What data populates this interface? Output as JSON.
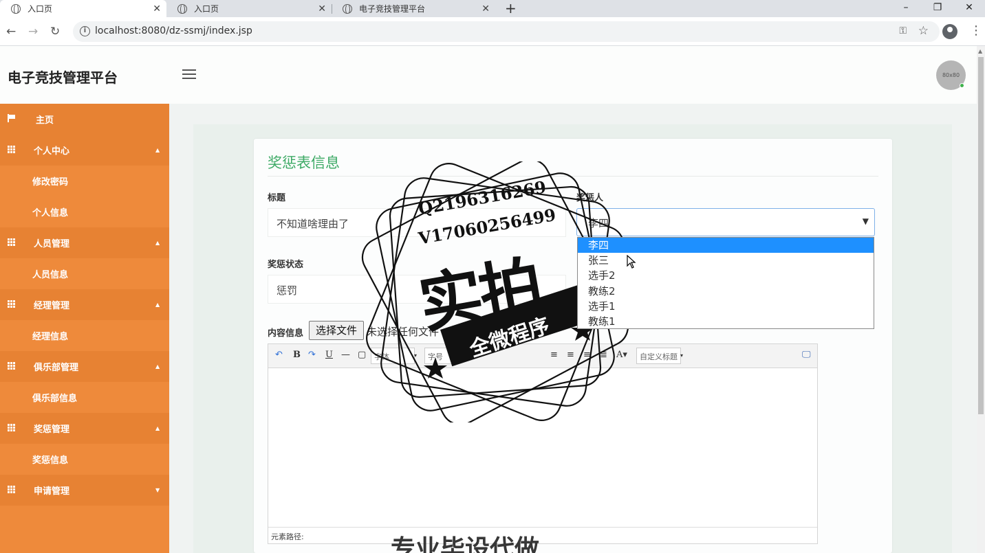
{
  "browser": {
    "tabs": [
      {
        "title": "入口页",
        "close": "✕"
      },
      {
        "title": "入口页",
        "close": "✕"
      },
      {
        "title": "电子竞技管理平台",
        "close": "✕"
      }
    ],
    "new_tab": "+",
    "url": "localhost:8080/dz-ssmj/index.jsp"
  },
  "app": {
    "brand": "电子竞技管理平台",
    "avatar_text": "80x80"
  },
  "sidebar": {
    "home": "主页",
    "items": [
      {
        "label": "个人中心",
        "type": "group"
      },
      {
        "label": "修改密码",
        "type": "sub"
      },
      {
        "label": "个人信息",
        "type": "sub"
      },
      {
        "label": "人员管理",
        "type": "group"
      },
      {
        "label": "人员信息",
        "type": "sub"
      },
      {
        "label": "经理管理",
        "type": "group"
      },
      {
        "label": "经理信息",
        "type": "sub"
      },
      {
        "label": "俱乐部管理",
        "type": "group"
      },
      {
        "label": "俱乐部信息",
        "type": "sub"
      },
      {
        "label": "奖惩管理",
        "type": "group"
      },
      {
        "label": "奖惩信息",
        "type": "sub"
      },
      {
        "label": "申请管理",
        "type": "group"
      }
    ]
  },
  "form": {
    "title": "奖惩表信息",
    "title_label": "标题",
    "title_value": "不知道啥理由了",
    "person_label": "奖惩人",
    "person_value": "李四",
    "person_options": [
      "李四",
      "张三",
      "选手2",
      "教练2",
      "选手1",
      "教练1"
    ],
    "status_label": "奖惩状态",
    "status_value": "惩罚",
    "content_label": "内容信息",
    "file_button": "选择文件",
    "file_status": "未选择任何文件"
  },
  "editor": {
    "font_family": "字体",
    "font_size": "字号",
    "custom_heading": "自定义标题",
    "path_label": "元素路径:"
  },
  "watermark": {
    "line1": "Q2196316269",
    "line2": "V17060256499",
    "big": "实拍",
    "ribbon": "全微程序",
    "bottom": "专业毕设代做"
  },
  "colors": {
    "sidebar": "#ee8a3b",
    "accent_title": "#3eaa66",
    "selected_option": "#1e90ff"
  }
}
